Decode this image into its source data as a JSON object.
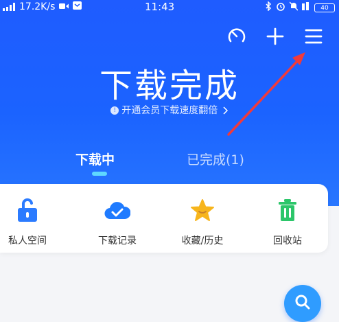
{
  "status_bar": {
    "network_speed": "17.2K/s",
    "time": "11:43",
    "battery": "40"
  },
  "header": {
    "title": "下载完成",
    "vip_promo": "开通会员下载速度翻倍",
    "icons": [
      "speedometer-icon",
      "plus-icon",
      "menu-icon"
    ]
  },
  "tabs": [
    {
      "label": "下载中",
      "active": true
    },
    {
      "label": "已完成(1)",
      "active": false
    }
  ],
  "tools": [
    {
      "label": "私人空间",
      "icon": "lock-icon",
      "color": "#2b7bff"
    },
    {
      "label": "下载记录",
      "icon": "cloud-check-icon",
      "color": "#1f7bff"
    },
    {
      "label": "收藏/历史",
      "icon": "star-icon",
      "color": "#f7b51c"
    },
    {
      "label": "回收站",
      "icon": "trash-icon",
      "color": "#2cc66a"
    }
  ],
  "colors": {
    "header_blue": "#1f5cff",
    "tab_indicator": "#5fd8ff",
    "fab": "#2f9cff"
  }
}
